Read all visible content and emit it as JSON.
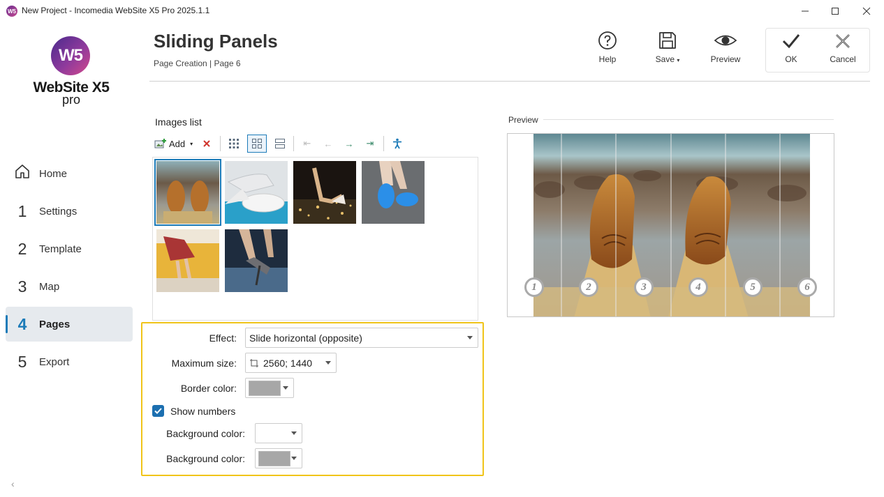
{
  "window": {
    "title": "New Project - Incomedia WebSite X5 Pro 2025.1.1",
    "app_icon_text": "W5"
  },
  "logo": {
    "mark": "W5",
    "name": "WebSite X5",
    "edition": "pro"
  },
  "nav": {
    "items": [
      {
        "num": "",
        "label": "Home",
        "icon": "home-icon"
      },
      {
        "num": "1",
        "label": "Settings"
      },
      {
        "num": "2",
        "label": "Template"
      },
      {
        "num": "3",
        "label": "Map"
      },
      {
        "num": "4",
        "label": "Pages",
        "active": true
      },
      {
        "num": "5",
        "label": "Export"
      }
    ]
  },
  "header": {
    "title": "Sliding Panels",
    "breadcrumb": "Page Creation | Page 6"
  },
  "toolbar": {
    "help_label": "Help",
    "save_label": "Save",
    "preview_label": "Preview",
    "ok_label": "OK",
    "cancel_label": "Cancel"
  },
  "images_list": {
    "title": "Images list",
    "add_label": "Add",
    "thumbnails": [
      "boots-on-rocks",
      "tying-white-sneaker",
      "heels-glitter",
      "blue-sneakers",
      "woman-yellow-sofa",
      "glitter-heels"
    ]
  },
  "settings": {
    "effect_label": "Effect:",
    "effect_value": "Slide horizontal (opposite)",
    "max_size_label": "Maximum size:",
    "max_size_value": "2560; 1440",
    "border_color_label": "Border color:",
    "border_color": "#a7a7a7",
    "show_numbers_label": "Show numbers",
    "show_numbers_checked": true,
    "bg_color_label_1": "Background color:",
    "bg_color_1": "#ffffff",
    "bg_color_label_2": "Background color:",
    "bg_color_2": "#a7a7a7"
  },
  "preview": {
    "label": "Preview",
    "numbers": [
      "1",
      "2",
      "3",
      "4",
      "5",
      "6"
    ]
  },
  "colors": {
    "accent": "#1c7bb8",
    "highlight": "#f0c419"
  }
}
